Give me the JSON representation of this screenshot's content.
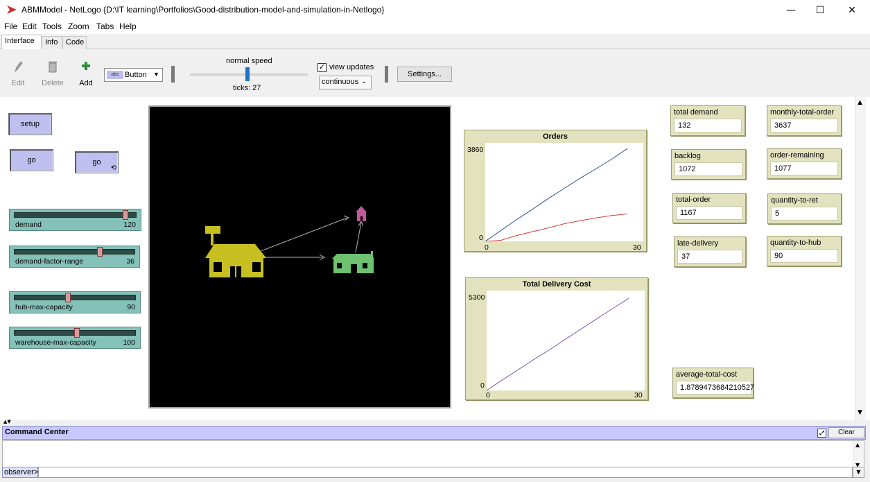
{
  "window": {
    "title": "ABMModel - NetLogo {D:\\IT learning\\Portfolios\\Good-distribution-model-and-simulation-in-Netlogo}",
    "minimize": "—",
    "maximize": "☐",
    "close": "✕"
  },
  "menu": [
    "File",
    "Edit",
    "Tools",
    "Zoom",
    "Tabs",
    "Help"
  ],
  "tabs": [
    "Interface",
    "Info",
    "Code"
  ],
  "toolbar": {
    "edit": "Edit",
    "delete": "Delete",
    "add": "Add",
    "widget_type": "Button",
    "widget_type_icon_text": "abc",
    "speed_label": "normal speed",
    "ticks_label": "ticks: 27",
    "speed_fraction": 0.49,
    "view_updates_label": "view updates",
    "view_updates_checked": true,
    "update_mode": "continuous",
    "settings": "Settings..."
  },
  "buttons": {
    "setup": "setup",
    "go_once": "go",
    "go_forever": "go"
  },
  "sliders": [
    {
      "name": "demand",
      "value": "120",
      "fraction": 0.93
    },
    {
      "name": "demand-factor-range",
      "value": "36",
      "fraction": 0.72
    },
    {
      "name": "hub-max-capacity",
      "value": "90",
      "fraction": 0.44
    },
    {
      "name": "warehouse-max-capacity",
      "value": "100",
      "fraction": 0.52
    }
  ],
  "monitors": {
    "total_demand": {
      "name": "total demand",
      "value": "132"
    },
    "monthly_total_order": {
      "name": "monthly-total-order",
      "value": "3637"
    },
    "backlog": {
      "name": "backlog",
      "value": "1072"
    },
    "order_remaining": {
      "name": "order-remaining",
      "value": "1077"
    },
    "total_order": {
      "name": "total-order",
      "value": "1167"
    },
    "quantity_to_ret": {
      "name": "quantity-to-ret",
      "value": "5"
    },
    "late_delivery": {
      "name": "late-delivery",
      "value": "37"
    },
    "quantity_to_hub": {
      "name": "quantity-to-hub",
      "value": "90"
    },
    "average_total_cost": {
      "name": "average-total-cost",
      "value": "1.8789473684210527"
    }
  },
  "colors": {
    "button": "#bfbff0",
    "slider": "#84c1b9",
    "monitor": "#e2e2bf",
    "warehouse": "#c8c020",
    "hub": "#6ec16e",
    "retailer": "#c05a9a",
    "series_blue": "#2f4f8f",
    "series_red": "#d0403a",
    "series_purple": "#7b5aa6"
  },
  "command_center": {
    "title": "Command Center",
    "clear": "Clear",
    "prompt": "observer>"
  },
  "chart_data": [
    {
      "type": "line",
      "title": "Orders",
      "xlim": [
        0,
        30
      ],
      "ylim": [
        0,
        3860
      ],
      "x_ticks": [
        "0",
        "30"
      ],
      "y_ticks": [
        "0",
        "3860"
      ],
      "series": [
        {
          "color": "#2f4f8f",
          "x": [
            0,
            3,
            6,
            9,
            12,
            15,
            18,
            21,
            24,
            27
          ],
          "y": [
            0,
            430,
            860,
            1260,
            1680,
            2080,
            2470,
            2840,
            3220,
            3637
          ]
        },
        {
          "color": "#d0403a",
          "x": [
            0,
            3,
            6,
            9,
            12,
            15,
            18,
            21,
            24,
            27
          ],
          "y": [
            0,
            40,
            230,
            380,
            530,
            690,
            810,
            920,
            1010,
            1077
          ]
        }
      ]
    },
    {
      "type": "line",
      "title": "Total Delivery Cost",
      "xlim": [
        0,
        30
      ],
      "ylim": [
        0,
        5300
      ],
      "x_ticks": [
        "0",
        "30"
      ],
      "y_ticks": [
        "0",
        "5300"
      ],
      "series": [
        {
          "color": "#7b5aa6",
          "x": [
            0,
            3,
            6,
            9,
            12,
            15,
            18,
            21,
            24,
            27
          ],
          "y": [
            0,
            560,
            1100,
            1650,
            2170,
            2730,
            3270,
            3820,
            4360,
            4900
          ]
        }
      ]
    }
  ]
}
